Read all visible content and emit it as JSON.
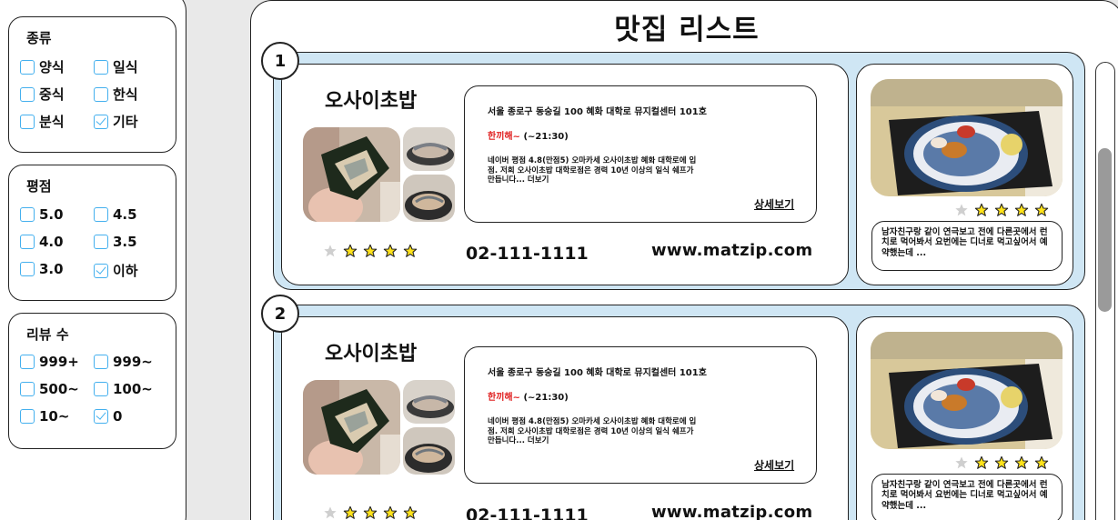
{
  "page_title": "맛집 리스트",
  "filters": {
    "type": {
      "title": "종류",
      "options": [
        {
          "label": "양식",
          "checked": false
        },
        {
          "label": "일식",
          "checked": false
        },
        {
          "label": "중식",
          "checked": false
        },
        {
          "label": "한식",
          "checked": false
        },
        {
          "label": "분식",
          "checked": false
        },
        {
          "label": "기타",
          "checked": true
        }
      ]
    },
    "rating": {
      "title": "평점",
      "options": [
        {
          "label": "5.0",
          "checked": false
        },
        {
          "label": "4.5",
          "checked": false
        },
        {
          "label": "4.0",
          "checked": false
        },
        {
          "label": "3.5",
          "checked": false
        },
        {
          "label": "3.0",
          "checked": false
        },
        {
          "label": "이하",
          "checked": true
        }
      ]
    },
    "reviews": {
      "title": "리뷰 수",
      "options": [
        {
          "label": "999+",
          "checked": false
        },
        {
          "label": "999~",
          "checked": false
        },
        {
          "label": "500~",
          "checked": false
        },
        {
          "label": "100~",
          "checked": false
        },
        {
          "label": "10~",
          "checked": false
        },
        {
          "label": "0",
          "checked": true
        }
      ]
    }
  },
  "restaurants": [
    {
      "index": "1",
      "name": "오사이초밥",
      "address": "서울 종로구 동숭길 100 혜화 대학로 뮤지컬센터 101호",
      "hours_highlight": "한끼해~",
      "hours_text": " (~21:30)",
      "description": "네이버 평점 4.8(만점5) 오마카세 오사이초밥 혜화 대학로에 입점. 저희 오사이초밥 대학로점은 경력 10년 이상의 일식 쉐프가 만듭니다... 더보기",
      "more_label": "상세보기",
      "phone": "02-111-1111",
      "website": "www.matzip.com",
      "rating_stars": 4,
      "review_stars": 4,
      "review_text": "남자친구랑 같이 연극보고 전에 다른곳에서 런치로 먹어봐서 요번에는 디너로 먹고싶어서 예약했는데 ..."
    },
    {
      "index": "2",
      "name": "오사이초밥",
      "address": "서울 종로구 동숭길 100 혜화 대학로 뮤지컬센터 101호",
      "hours_highlight": "한끼해~",
      "hours_text": " (~21:30)",
      "description": "네이버 평점 4.8(만점5) 오마카세 오사이초밥 혜화 대학로에 입점. 저희 오사이초밥 대학로점은 경력 10년 이상의 일식 쉐프가 만듭니다... 더보기",
      "more_label": "상세보기",
      "phone": "02-111-1111",
      "website": "www.matzip.com",
      "rating_stars": 4,
      "review_stars": 4,
      "review_text": "남자친구랑 같이 연극보고 전에 다른곳에서 런치로 먹어봐서 요번에는 디너로 먹고싶어서 예약했는데 ..."
    }
  ],
  "colors": {
    "card_bg": "#cfe6f4",
    "checkbox": "#44b0ee",
    "star_fill": "#ffe21a",
    "star_empty": "#cfcfcf",
    "highlight": "#e02020"
  },
  "icons": {
    "star": "star-icon",
    "checkbox": "checkbox-icon"
  }
}
